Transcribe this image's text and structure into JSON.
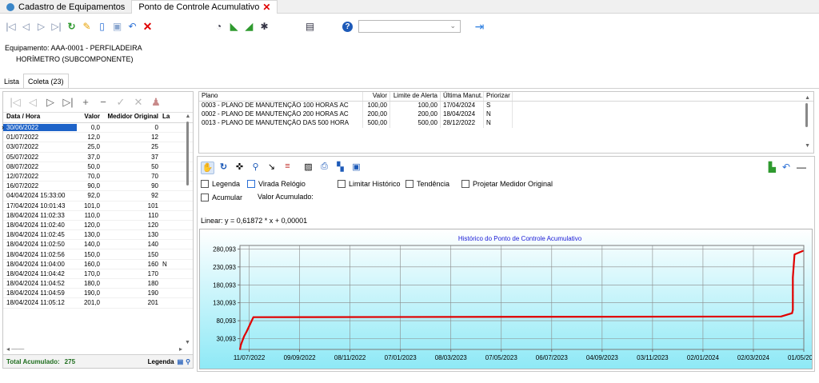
{
  "tabs": [
    {
      "label": "Cadastro de Equipamentos",
      "active": false
    },
    {
      "label": "Ponto de Controle Acumulativo",
      "active": true
    }
  ],
  "toolbar": {
    "combo_value": ""
  },
  "equipment": {
    "line1": "Equipamento:  AAA-0001 - PERFILADEIRA",
    "line2": "HORÍMETRO (SUBCOMPONENTE)"
  },
  "subtabs": [
    {
      "label": "Lista",
      "active": false
    },
    {
      "label": "Coleta (23)",
      "active": true
    }
  ],
  "grid": {
    "headers": {
      "date": "Data / Hora",
      "value": "Valor",
      "original": "Medidor Original",
      "flag": "La"
    },
    "rows": [
      {
        "date": "30/06/2022",
        "value": "0,0",
        "original": "0",
        "flag": ""
      },
      {
        "date": "01/07/2022",
        "value": "12,0",
        "original": "12",
        "flag": ""
      },
      {
        "date": "03/07/2022",
        "value": "25,0",
        "original": "25",
        "flag": ""
      },
      {
        "date": "05/07/2022",
        "value": "37,0",
        "original": "37",
        "flag": ""
      },
      {
        "date": "08/07/2022",
        "value": "50,0",
        "original": "50",
        "flag": ""
      },
      {
        "date": "12/07/2022",
        "value": "70,0",
        "original": "70",
        "flag": ""
      },
      {
        "date": "16/07/2022",
        "value": "90,0",
        "original": "90",
        "flag": ""
      },
      {
        "date": "04/04/2024 15:33:00",
        "value": "92,0",
        "original": "92",
        "flag": ""
      },
      {
        "date": "17/04/2024 10:01:43",
        "value": "101,0",
        "original": "101",
        "flag": ""
      },
      {
        "date": "18/04/2024 11:02:33",
        "value": "110,0",
        "original": "110",
        "flag": ""
      },
      {
        "date": "18/04/2024 11:02:40",
        "value": "120,0",
        "original": "120",
        "flag": ""
      },
      {
        "date": "18/04/2024 11:02:45",
        "value": "130,0",
        "original": "130",
        "flag": ""
      },
      {
        "date": "18/04/2024 11:02:50",
        "value": "140,0",
        "original": "140",
        "flag": ""
      },
      {
        "date": "18/04/2024 11:02:56",
        "value": "150,0",
        "original": "150",
        "flag": ""
      },
      {
        "date": "18/04/2024 11:04:00",
        "value": "160,0",
        "original": "160",
        "flag": "N"
      },
      {
        "date": "18/04/2024 11:04:42",
        "value": "170,0",
        "original": "170",
        "flag": ""
      },
      {
        "date": "18/04/2024 11:04:52",
        "value": "180,0",
        "original": "180",
        "flag": ""
      },
      {
        "date": "18/04/2024 11:04:59",
        "value": "190,0",
        "original": "190",
        "flag": ""
      },
      {
        "date": "18/04/2024 11:05:12",
        "value": "201,0",
        "original": "201",
        "flag": ""
      }
    ]
  },
  "footer": {
    "total_label": "Total Acumulado:",
    "total_value": "275",
    "legend_label": "Legenda"
  },
  "plans": {
    "headers": {
      "plan": "Plano",
      "value": "Valor",
      "alert": "Limite de Alerta",
      "last": "Última Manut.",
      "priority": "Priorizar"
    },
    "rows": [
      {
        "plan": "0003 - PLANO DE MANUTENÇÃO 100 HORAS AC",
        "value": "100,00",
        "alert": "100,00",
        "last": "17/04/2024",
        "priority": "S"
      },
      {
        "plan": "0002 - PLANO DE MANUTENÇÃO 200 HORAS AC",
        "value": "200,00",
        "alert": "200,00",
        "last": "18/04/2024",
        "priority": "N"
      },
      {
        "plan": "0013 - PLANO DE MANUTENÇÃO DAS 500 HORA",
        "value": "500,00",
        "alert": "500,00",
        "last": "28/12/2022",
        "priority": "N"
      }
    ]
  },
  "chart_options": {
    "legenda": "Legenda",
    "virada": "Virada Relógio",
    "limitar": "Limitar Histórico",
    "tendencia": "Tendência",
    "projetar": "Projetar Medidor Original",
    "acumular": "Acumular",
    "valor_acumulado": "Valor Acumulado:",
    "linear": "Linear: y = 0,61872 * x + 0,00001"
  },
  "colors": {
    "accent": "#1e63c8",
    "series": "#e00000",
    "plot_bg_top": "#ffffff",
    "plot_bg_bottom": "#8ee9f6",
    "title": "#1a1ad6"
  },
  "chart_data": {
    "type": "line",
    "title": "Histórico do Ponto de Controle Acumulativo",
    "xlabel": "",
    "ylabel": "",
    "y_ticks": [
      "30,093",
      "80,093",
      "130,093",
      "180,093",
      "230,093",
      "280,093"
    ],
    "y_tick_values": [
      30.093,
      80.093,
      130.093,
      180.093,
      230.093,
      280.093
    ],
    "ylim": [
      0,
      290
    ],
    "x_ticks": [
      "11/07/2022",
      "09/09/2022",
      "08/11/2022",
      "07/01/2023",
      "08/03/2023",
      "07/05/2023",
      "06/07/2023",
      "04/09/2023",
      "03/11/2023",
      "02/01/2024",
      "02/03/2024",
      "01/05/2024"
    ],
    "x_tick_dates": [
      "2022-07-11",
      "2022-09-09",
      "2022-11-08",
      "2023-01-07",
      "2023-03-08",
      "2023-05-07",
      "2023-07-06",
      "2023-09-04",
      "2023-11-03",
      "2024-01-02",
      "2024-03-02",
      "2024-05-01"
    ],
    "xlim": [
      "2022-06-30",
      "2024-05-01"
    ],
    "grid": true,
    "series": [
      {
        "points": [
          [
            "2022-06-30",
            0
          ],
          [
            "2022-07-01",
            12
          ],
          [
            "2022-07-03",
            25
          ],
          [
            "2022-07-05",
            37
          ],
          [
            "2022-07-08",
            50
          ],
          [
            "2022-07-12",
            70
          ],
          [
            "2022-07-16",
            90
          ],
          [
            "2024-04-04",
            92
          ],
          [
            "2024-04-17",
            101
          ],
          [
            "2024-04-18",
            110
          ],
          [
            "2024-04-18",
            120
          ],
          [
            "2024-04-18",
            130
          ],
          [
            "2024-04-18",
            140
          ],
          [
            "2024-04-18",
            150
          ],
          [
            "2024-04-18",
            160
          ],
          [
            "2024-04-18",
            170
          ],
          [
            "2024-04-18",
            180
          ],
          [
            "2024-04-18",
            190
          ],
          [
            "2024-04-18",
            201
          ],
          [
            "2024-04-20",
            265
          ],
          [
            "2024-04-30",
            275
          ]
        ]
      }
    ]
  }
}
